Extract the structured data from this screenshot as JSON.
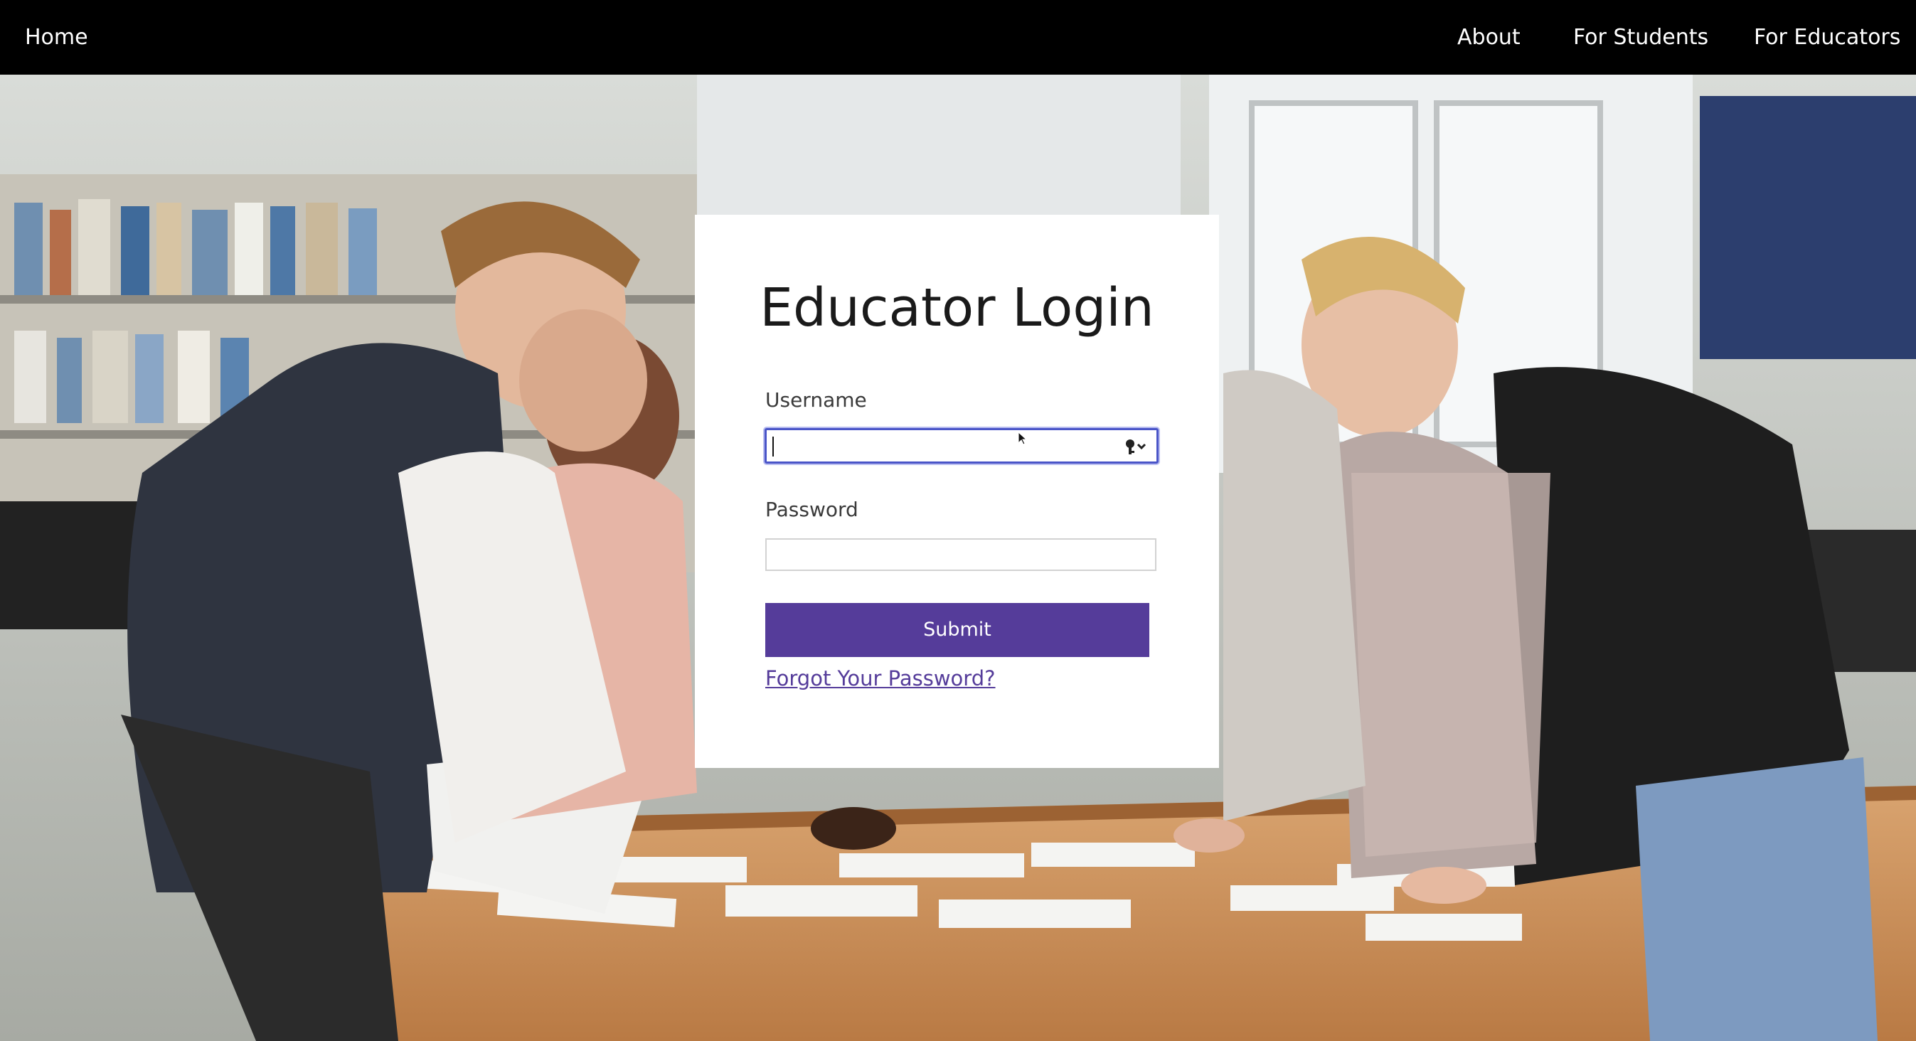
{
  "nav": {
    "home": "Home",
    "about": "About",
    "students": "For Students",
    "educators": "For Educators"
  },
  "login": {
    "title": "Educator Login",
    "username_label": "Username",
    "username_value": "",
    "password_label": "Password",
    "password_value": "",
    "submit_label": "Submit",
    "forgot_label": "Forgot Your Password?"
  },
  "icons": {
    "password_manager": "key-dropdown-icon",
    "mouse": "mouse-cursor-icon"
  },
  "colors": {
    "topbar": "#000000",
    "accent": "#553c9a",
    "focus_ring": "#4a55c8"
  },
  "background_image": "classroom-students-photo"
}
